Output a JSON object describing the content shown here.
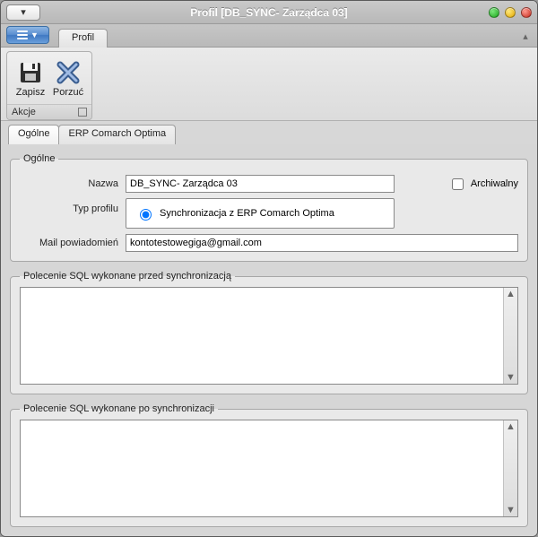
{
  "window": {
    "title": "Profil [DB_SYNC- Zarządca 03]"
  },
  "ribbon": {
    "tab_label": "Profil",
    "group_label": "Akcje",
    "save_label": "Zapisz",
    "abandon_label": "Porzuć"
  },
  "tabs": {
    "general": "Ogólne",
    "erp": "ERP Comarch Optima"
  },
  "general": {
    "legend": "Ogólne",
    "name_label": "Nazwa",
    "name_value": "DB_SYNC- Zarządca 03",
    "type_label": "Typ profilu",
    "type_option": "Synchronizacja z ERP Comarch Optima",
    "archival_label": "Archiwalny",
    "archival_checked": false,
    "mail_label": "Mail powiadomień",
    "mail_value": "kontotestowegiga@gmail.com"
  },
  "sql_before": {
    "legend": "Polecenie SQL wykonane przed synchronizacją",
    "value": ""
  },
  "sql_after": {
    "legend": "Polecenie SQL wykonane po synchronizacji",
    "value": ""
  }
}
